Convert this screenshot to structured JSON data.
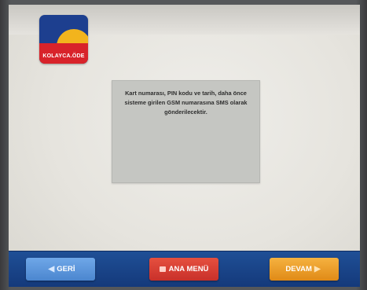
{
  "logo": {
    "text": "KOLAYCA.ÖDE",
    "colors": {
      "blue": "#1d3f8f",
      "red": "#d8232a",
      "sun": "#f2b41d"
    }
  },
  "message": {
    "text": "Kart numarası, PIN kodu ve tarih, daha önce sisteme girilen GSM numarasına SMS olarak gönderilecektir."
  },
  "buttons": {
    "back": {
      "label": "GERİ",
      "icon": "chevron-left-icon",
      "color": "#4b86cf"
    },
    "main_menu": {
      "label": "ANA MENÜ",
      "icon": "home-icon",
      "color": "#c8302a"
    },
    "next": {
      "label": "DEVAM",
      "icon": "chevron-right-icon",
      "color": "#e08a17"
    }
  },
  "colors": {
    "bottom_bar": "#1f4f96",
    "panel": "#c5c6c2",
    "screen_bg": "#e6e4de"
  }
}
